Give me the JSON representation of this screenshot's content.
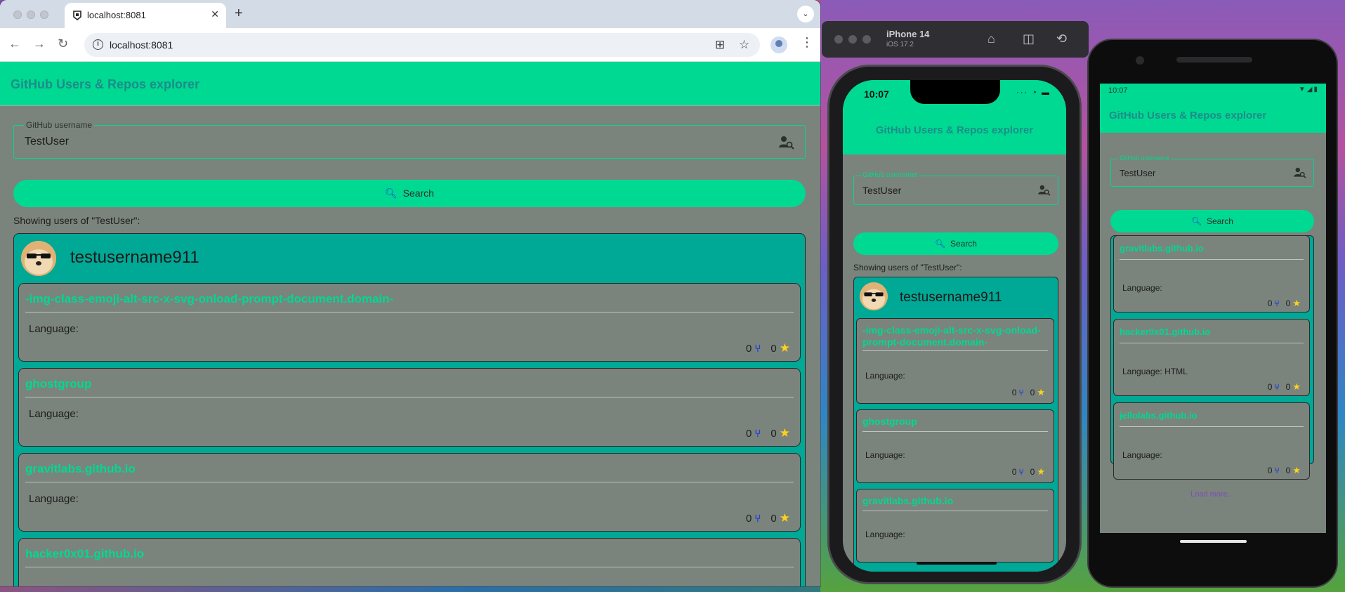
{
  "browser": {
    "tab_title": "localhost:8081",
    "url": "localhost:8081",
    "new_tab": "+",
    "close": "✕"
  },
  "app": {
    "title": "GitHub Users & Repos explorer",
    "field_label": "GitHub username",
    "field_value": "TestUser",
    "search_label": "Search",
    "showing": "Showing users of \"TestUser\":",
    "username": "testusername911",
    "language_label": "Language:",
    "load_more": "Load more..."
  },
  "repos": [
    {
      "name": "-img-class-emoji-alt-src-x-svg-onload-prompt-document.domain-",
      "language": "",
      "forks": "0",
      "stars": "0"
    },
    {
      "name": "ghostgroup",
      "language": "",
      "forks": "0",
      "stars": "0"
    },
    {
      "name": "gravitlabs.github.io",
      "language": "",
      "forks": "0",
      "stars": "0"
    },
    {
      "name": "hacker0x01.github.io",
      "language": "HTML",
      "forks": "0",
      "stars": "0"
    },
    {
      "name": "jellolabs.github.io",
      "language": "",
      "forks": "0",
      "stars": "0"
    }
  ],
  "simulator": {
    "device_name": "iPhone 14",
    "os_version": "iOS 17.2",
    "ios_time": "10:07",
    "android_time": "10:07"
  },
  "colors": {
    "accent": "#00d991",
    "card": "#00a896",
    "surface": "#7b837d",
    "title": "#1c8d8a",
    "fork": "#1d3fe0",
    "star": "#ffd21a"
  }
}
